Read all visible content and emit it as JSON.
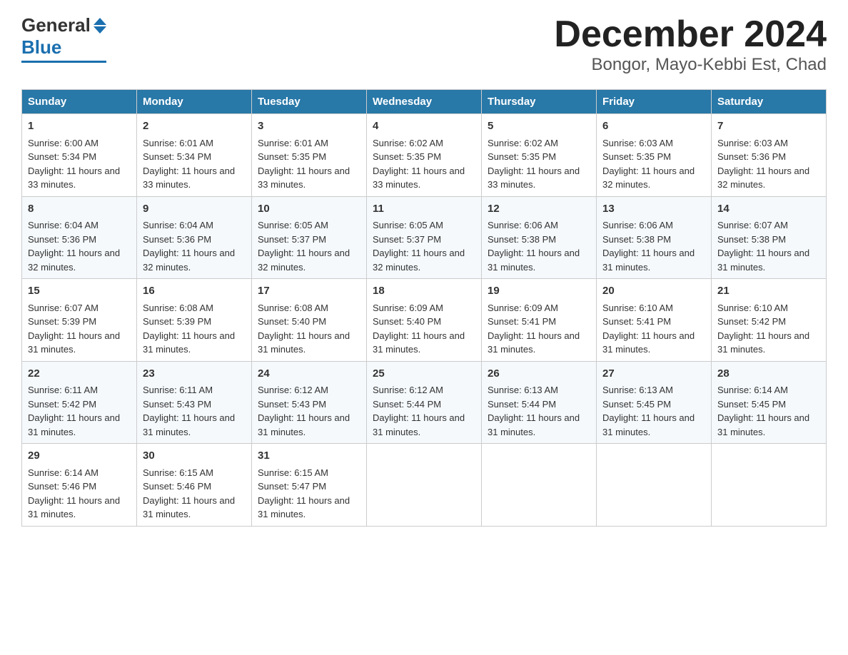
{
  "header": {
    "month_title": "December 2024",
    "location": "Bongor, Mayo-Kebbi Est, Chad",
    "logo_general": "General",
    "logo_blue": "Blue"
  },
  "days_of_week": [
    "Sunday",
    "Monday",
    "Tuesday",
    "Wednesday",
    "Thursday",
    "Friday",
    "Saturday"
  ],
  "weeks": [
    [
      {
        "day": "1",
        "sunrise": "6:00 AM",
        "sunset": "5:34 PM",
        "daylight": "11 hours and 33 minutes."
      },
      {
        "day": "2",
        "sunrise": "6:01 AM",
        "sunset": "5:34 PM",
        "daylight": "11 hours and 33 minutes."
      },
      {
        "day": "3",
        "sunrise": "6:01 AM",
        "sunset": "5:35 PM",
        "daylight": "11 hours and 33 minutes."
      },
      {
        "day": "4",
        "sunrise": "6:02 AM",
        "sunset": "5:35 PM",
        "daylight": "11 hours and 33 minutes."
      },
      {
        "day": "5",
        "sunrise": "6:02 AM",
        "sunset": "5:35 PM",
        "daylight": "11 hours and 33 minutes."
      },
      {
        "day": "6",
        "sunrise": "6:03 AM",
        "sunset": "5:35 PM",
        "daylight": "11 hours and 32 minutes."
      },
      {
        "day": "7",
        "sunrise": "6:03 AM",
        "sunset": "5:36 PM",
        "daylight": "11 hours and 32 minutes."
      }
    ],
    [
      {
        "day": "8",
        "sunrise": "6:04 AM",
        "sunset": "5:36 PM",
        "daylight": "11 hours and 32 minutes."
      },
      {
        "day": "9",
        "sunrise": "6:04 AM",
        "sunset": "5:36 PM",
        "daylight": "11 hours and 32 minutes."
      },
      {
        "day": "10",
        "sunrise": "6:05 AM",
        "sunset": "5:37 PM",
        "daylight": "11 hours and 32 minutes."
      },
      {
        "day": "11",
        "sunrise": "6:05 AM",
        "sunset": "5:37 PM",
        "daylight": "11 hours and 32 minutes."
      },
      {
        "day": "12",
        "sunrise": "6:06 AM",
        "sunset": "5:38 PM",
        "daylight": "11 hours and 31 minutes."
      },
      {
        "day": "13",
        "sunrise": "6:06 AM",
        "sunset": "5:38 PM",
        "daylight": "11 hours and 31 minutes."
      },
      {
        "day": "14",
        "sunrise": "6:07 AM",
        "sunset": "5:38 PM",
        "daylight": "11 hours and 31 minutes."
      }
    ],
    [
      {
        "day": "15",
        "sunrise": "6:07 AM",
        "sunset": "5:39 PM",
        "daylight": "11 hours and 31 minutes."
      },
      {
        "day": "16",
        "sunrise": "6:08 AM",
        "sunset": "5:39 PM",
        "daylight": "11 hours and 31 minutes."
      },
      {
        "day": "17",
        "sunrise": "6:08 AM",
        "sunset": "5:40 PM",
        "daylight": "11 hours and 31 minutes."
      },
      {
        "day": "18",
        "sunrise": "6:09 AM",
        "sunset": "5:40 PM",
        "daylight": "11 hours and 31 minutes."
      },
      {
        "day": "19",
        "sunrise": "6:09 AM",
        "sunset": "5:41 PM",
        "daylight": "11 hours and 31 minutes."
      },
      {
        "day": "20",
        "sunrise": "6:10 AM",
        "sunset": "5:41 PM",
        "daylight": "11 hours and 31 minutes."
      },
      {
        "day": "21",
        "sunrise": "6:10 AM",
        "sunset": "5:42 PM",
        "daylight": "11 hours and 31 minutes."
      }
    ],
    [
      {
        "day": "22",
        "sunrise": "6:11 AM",
        "sunset": "5:42 PM",
        "daylight": "11 hours and 31 minutes."
      },
      {
        "day": "23",
        "sunrise": "6:11 AM",
        "sunset": "5:43 PM",
        "daylight": "11 hours and 31 minutes."
      },
      {
        "day": "24",
        "sunrise": "6:12 AM",
        "sunset": "5:43 PM",
        "daylight": "11 hours and 31 minutes."
      },
      {
        "day": "25",
        "sunrise": "6:12 AM",
        "sunset": "5:44 PM",
        "daylight": "11 hours and 31 minutes."
      },
      {
        "day": "26",
        "sunrise": "6:13 AM",
        "sunset": "5:44 PM",
        "daylight": "11 hours and 31 minutes."
      },
      {
        "day": "27",
        "sunrise": "6:13 AM",
        "sunset": "5:45 PM",
        "daylight": "11 hours and 31 minutes."
      },
      {
        "day": "28",
        "sunrise": "6:14 AM",
        "sunset": "5:45 PM",
        "daylight": "11 hours and 31 minutes."
      }
    ],
    [
      {
        "day": "29",
        "sunrise": "6:14 AM",
        "sunset": "5:46 PM",
        "daylight": "11 hours and 31 minutes."
      },
      {
        "day": "30",
        "sunrise": "6:15 AM",
        "sunset": "5:46 PM",
        "daylight": "11 hours and 31 minutes."
      },
      {
        "day": "31",
        "sunrise": "6:15 AM",
        "sunset": "5:47 PM",
        "daylight": "11 hours and 31 minutes."
      },
      null,
      null,
      null,
      null
    ]
  ],
  "labels": {
    "sunrise": "Sunrise:",
    "sunset": "Sunset:",
    "daylight": "Daylight:"
  }
}
